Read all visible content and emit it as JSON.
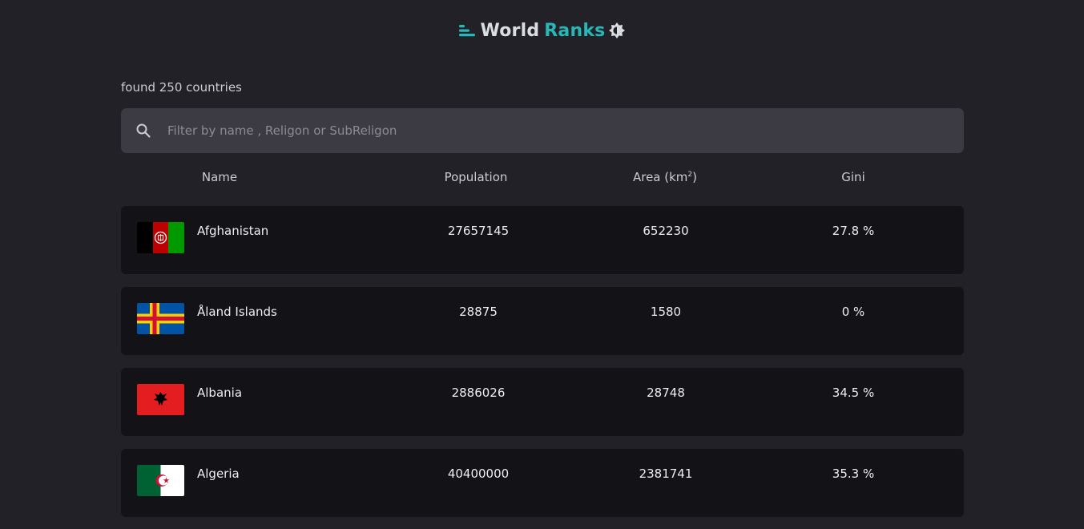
{
  "header": {
    "title_part1": "World",
    "title_part2": "Ranks",
    "logo_icon": "bars-icon",
    "theme_icon": "brightness-icon",
    "accent_color": "#27b7b6"
  },
  "summary": {
    "found_text": "found 250 countries"
  },
  "search": {
    "placeholder": "Filter by name , Religon or SubReligon",
    "value": ""
  },
  "columns": {
    "name": "Name",
    "population": "Population",
    "area_prefix": "Area (km",
    "area_sup": "2",
    "area_suffix": ")",
    "gini": "Gini"
  },
  "countries": [
    {
      "name": "Afghanistan",
      "population": "27657145",
      "area": "652230",
      "gini": "27.8 %",
      "flag": "afghanistan-flag"
    },
    {
      "name": "Åland Islands",
      "population": "28875",
      "area": "1580",
      "gini": "0 %",
      "flag": "aland-flag"
    },
    {
      "name": "Albania",
      "population": "2886026",
      "area": "28748",
      "gini": "34.5 %",
      "flag": "albania-flag"
    },
    {
      "name": "Algeria",
      "population": "40400000",
      "area": "2381741",
      "gini": "35.3 %",
      "flag": "algeria-flag"
    }
  ]
}
